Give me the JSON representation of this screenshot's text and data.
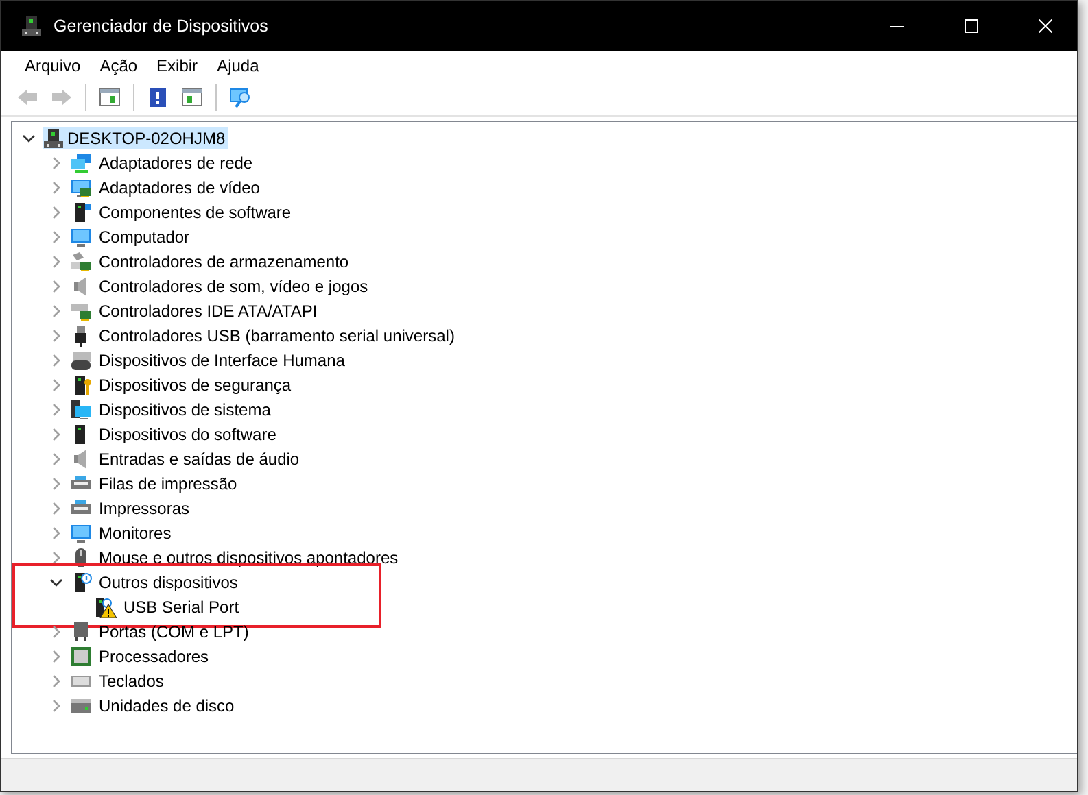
{
  "window": {
    "title": "Gerenciador de Dispositivos"
  },
  "menu": [
    "Arquivo",
    "Ação",
    "Exibir",
    "Ajuda"
  ],
  "toolbar": [
    {
      "kind": "back",
      "disabled": true
    },
    {
      "kind": "forward",
      "disabled": true
    },
    {
      "kind": "separator"
    },
    {
      "kind": "console-tree"
    },
    {
      "kind": "separator"
    },
    {
      "kind": "help"
    },
    {
      "kind": "properties"
    },
    {
      "kind": "separator"
    },
    {
      "kind": "scan"
    }
  ],
  "tree": {
    "label": "DESKTOP-02OHJM8",
    "expanded": true,
    "selected": true,
    "children": [
      {
        "label": "Adaptadores de rede",
        "expanded": false,
        "highlighted": false
      },
      {
        "label": "Adaptadores de vídeo",
        "expanded": false,
        "highlighted": false
      },
      {
        "label": "Componentes de software",
        "expanded": false,
        "highlighted": false
      },
      {
        "label": "Computador",
        "expanded": false,
        "highlighted": false
      },
      {
        "label": "Controladores de armazenamento",
        "expanded": false,
        "highlighted": false
      },
      {
        "label": "Controladores de som, vídeo e jogos",
        "expanded": false,
        "highlighted": false
      },
      {
        "label": "Controladores IDE ATA/ATAPI",
        "expanded": false,
        "highlighted": false
      },
      {
        "label": "Controladores USB (barramento serial universal)",
        "expanded": false,
        "highlighted": false
      },
      {
        "label": "Dispositivos de Interface Humana",
        "expanded": false,
        "highlighted": false
      },
      {
        "label": "Dispositivos de segurança",
        "expanded": false,
        "highlighted": false
      },
      {
        "label": "Dispositivos de sistema",
        "expanded": false,
        "highlighted": false
      },
      {
        "label": "Dispositivos do software",
        "expanded": false,
        "highlighted": false
      },
      {
        "label": "Entradas e saídas de áudio",
        "expanded": false,
        "highlighted": false
      },
      {
        "label": "Filas de impressão",
        "expanded": false,
        "highlighted": false
      },
      {
        "label": "Impressoras",
        "expanded": false,
        "highlighted": false
      },
      {
        "label": "Monitores",
        "expanded": false,
        "highlighted": false
      },
      {
        "label": "Mouse e outros dispositivos apontadores",
        "expanded": false,
        "highlighted": false
      },
      {
        "label": "Outros dispositivos",
        "expanded": true,
        "highlighted": true,
        "children": [
          {
            "label": "USB Serial Port",
            "warning": true
          }
        ]
      },
      {
        "label": "Portas (COM e LPT)",
        "expanded": false,
        "highlighted": false
      },
      {
        "label": "Processadores",
        "expanded": false,
        "highlighted": false
      },
      {
        "label": "Teclados",
        "expanded": false,
        "highlighted": false
      },
      {
        "label": "Unidades de disco",
        "expanded": false,
        "highlighted": false
      }
    ]
  }
}
